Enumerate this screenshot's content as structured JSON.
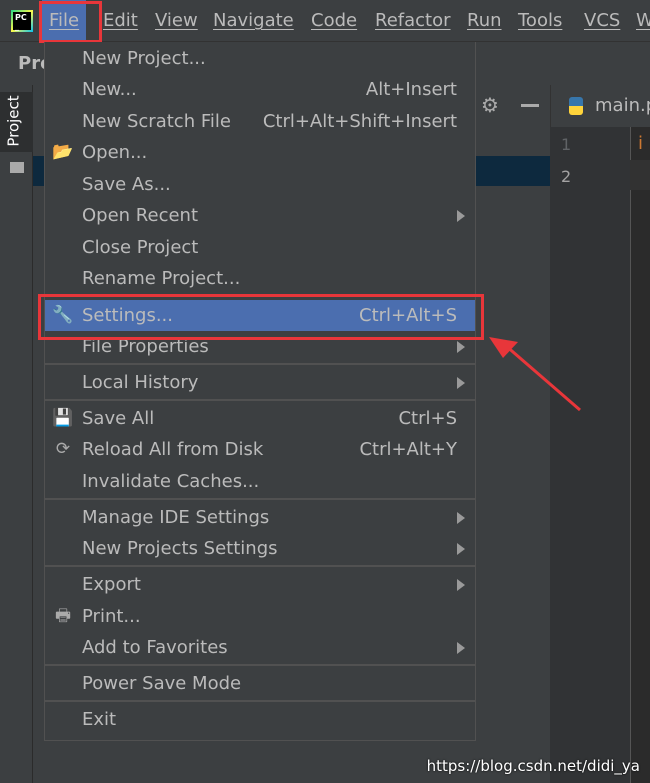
{
  "menubar": {
    "items": [
      "File",
      "Edit",
      "View",
      "Navigate",
      "Code",
      "Refactor",
      "Run",
      "Tools",
      "VCS",
      "W"
    ],
    "active": "File"
  },
  "toolbar": {
    "project_title": "Pro"
  },
  "sidebar": {
    "project_tab": "Project"
  },
  "editor": {
    "tab": "main.p",
    "line_numbers": [
      "1",
      "2"
    ],
    "code_char": "i"
  },
  "file_menu": {
    "items": [
      {
        "label": "New Project...",
        "shortcut": ""
      },
      {
        "label": "New...",
        "shortcut": "Alt+Insert"
      },
      {
        "label": "New Scratch File",
        "shortcut": "Ctrl+Alt+Shift+Insert"
      },
      {
        "label": "Open...",
        "shortcut": "",
        "icon": "folder-open-icon"
      },
      {
        "label": "Save As...",
        "shortcut": ""
      },
      {
        "label": "Open Recent",
        "submenu": true
      },
      {
        "label": "Close Project",
        "shortcut": ""
      },
      {
        "label": "Rename Project...",
        "shortcut": ""
      },
      {
        "label": "Settings...",
        "shortcut": "Ctrl+Alt+S",
        "icon": "wrench-icon",
        "highlighted": true
      },
      {
        "label": "File Properties",
        "submenu": true
      },
      {
        "label": "Local History",
        "submenu": true
      },
      {
        "label": "Save All",
        "shortcut": "Ctrl+S",
        "icon": "floppy-disk-icon"
      },
      {
        "label": "Reload All from Disk",
        "shortcut": "Ctrl+Alt+Y",
        "icon": "reload-icon"
      },
      {
        "label": "Invalidate Caches...",
        "shortcut": ""
      },
      {
        "label": "Manage IDE Settings",
        "submenu": true
      },
      {
        "label": "New Projects Settings",
        "submenu": true
      },
      {
        "label": "Export",
        "submenu": true
      },
      {
        "label": "Print...",
        "shortcut": "",
        "icon": "printer-icon"
      },
      {
        "label": "Add to Favorites",
        "submenu": true
      },
      {
        "label": "Power Save Mode",
        "shortcut": ""
      },
      {
        "label": "Exit",
        "shortcut": ""
      }
    ]
  },
  "colors": {
    "highlight": "#4b6eaf",
    "annotation": "#e8363a",
    "background": "#3c3f41"
  },
  "watermark": "https://blog.csdn.net/didi_ya"
}
